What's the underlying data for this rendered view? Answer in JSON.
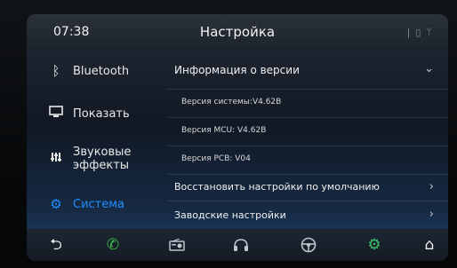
{
  "status": {
    "time": "07:38",
    "title": "Настройка"
  },
  "sidebar": {
    "items": [
      {
        "label": "Bluetooth",
        "icon": "bluetooth-icon",
        "active": false
      },
      {
        "label": "Показать",
        "icon": "display-icon",
        "active": false
      },
      {
        "label": "Звуковые эффекты",
        "icon": "equalizer-icon",
        "active": false
      },
      {
        "label": "Система",
        "icon": "gear-icon",
        "active": true
      }
    ]
  },
  "panel": {
    "version_info": "Информация о версии",
    "system_version": "Версия системы:V4.62B",
    "mcu_version": "Версия MCU: V4.62B",
    "pcb_version": "Версия PCB: V04",
    "restore_defaults": "Восстановить настройки по умолчанию",
    "factory_settings": "Заводские настройки"
  },
  "bottombar": {
    "icons": [
      "back-icon",
      "phone-icon",
      "radio-icon",
      "headphones-icon",
      "steering-wheel-icon",
      "gear-icon",
      "home-icon"
    ]
  },
  "colors": {
    "accent_blue": "#1f8fff",
    "phone_green": "#3fbf4a",
    "gear_green": "#39c06a"
  }
}
